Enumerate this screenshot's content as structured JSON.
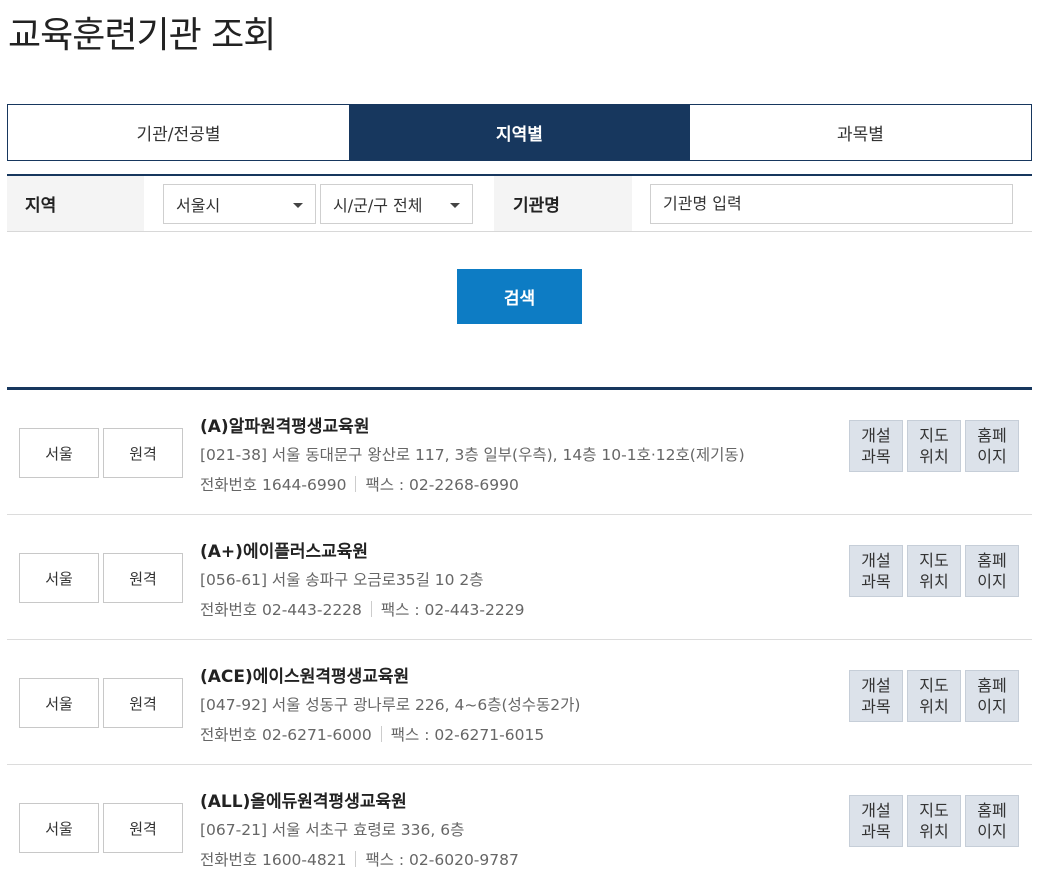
{
  "page": {
    "title": "교육훈련기관 조회"
  },
  "tabs": [
    {
      "label": "기관/전공별",
      "active": false
    },
    {
      "label": "지역별",
      "active": true
    },
    {
      "label": "과목별",
      "active": false
    }
  ],
  "filter": {
    "region_label": "지역",
    "city_value": "서울시",
    "district_value": "시/군/구 전체",
    "institution_label": "기관명",
    "institution_placeholder": "기관명 입력"
  },
  "search": {
    "label": "검색"
  },
  "colors": {
    "navy": "#17375e",
    "search_blue": "#0d7cc4",
    "action_bg": "#dce2ea"
  },
  "results": [
    {
      "region": "서울",
      "type": "원격",
      "name": "(A)알파원격평생교육원",
      "address": "[021-38] 서울 동대문구 왕산로 117, 3층 일부(우측), 14층 10-1호·12호(제기동)",
      "phone": "전화번호 1644-6990",
      "fax": "팩스 : 02-2268-6990",
      "actions": {
        "courses": "개설\n과목",
        "map": "지도\n위치",
        "home": "홈페\n이지"
      }
    },
    {
      "region": "서울",
      "type": "원격",
      "name": "(A+)에이플러스교육원",
      "address": "[056-61] 서울 송파구 오금로35길 10 2층",
      "phone": "전화번호 02-443-2228",
      "fax": "팩스 : 02-443-2229",
      "actions": {
        "courses": "개설\n과목",
        "map": "지도\n위치",
        "home": "홈페\n이지"
      }
    },
    {
      "region": "서울",
      "type": "원격",
      "name": "(ACE)에이스원격평생교육원",
      "address": "[047-92] 서울 성동구 광나루로 226, 4~6층(성수동2가)",
      "phone": "전화번호 02-6271-6000",
      "fax": "팩스 : 02-6271-6015",
      "actions": {
        "courses": "개설\n과목",
        "map": "지도\n위치",
        "home": "홈페\n이지"
      }
    },
    {
      "region": "서울",
      "type": "원격",
      "name": "(ALL)올에듀원격평생교육원",
      "address": "[067-21] 서울 서초구 효령로 336, 6층",
      "phone": "전화번호 1600-4821",
      "fax": "팩스 : 02-6020-9787",
      "actions": {
        "courses": "개설\n과목",
        "map": "지도\n위치",
        "home": "홈페\n이지"
      }
    }
  ]
}
